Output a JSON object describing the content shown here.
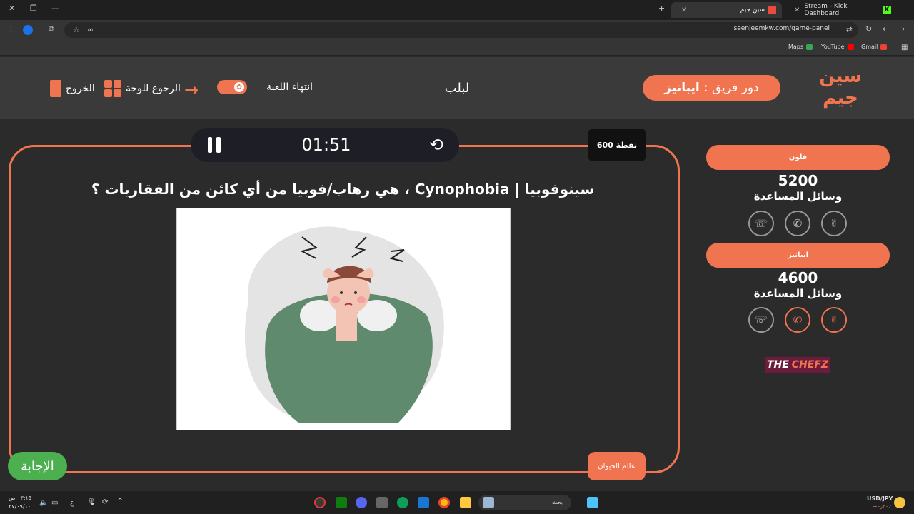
{
  "browser": {
    "tabs": [
      {
        "title": "سين جيم",
        "active": true
      },
      {
        "title": "Stream - Kick Dashboard",
        "active": false
      }
    ],
    "url": "seenjeemkw.com/game-panel",
    "bookmarks": [
      "Maps",
      "YouTube",
      "Gmail"
    ]
  },
  "header": {
    "logo_text": "سين جيم",
    "turn_prefix": "دور فريق :",
    "turn_team": "ايبانيز",
    "center_title": "لبلب",
    "end_game_label": "انتهاء اللعبة",
    "back_board_label": "الرجوع للوحة",
    "exit_label": "الخروج"
  },
  "game": {
    "timer": "01:51",
    "points": "600 نقطة",
    "question": "سينوفوبيا | Cynophobia ، هي رهاب/فوبيا من أي كائن من الفقاريات ؟",
    "category": "عالم الحيوان",
    "answer_label": "الإجابة"
  },
  "teams": [
    {
      "name": "فلون",
      "score": "5200",
      "aids_label": "وسائل المساعدة",
      "aids_active": [
        false,
        false,
        false
      ]
    },
    {
      "name": "ايبانيز",
      "score": "4600",
      "aids_label": "وسائل المساعدة",
      "aids_active": [
        false,
        true,
        true
      ]
    }
  ],
  "sponsor": {
    "part1": "THE",
    "part2": "CHEFZ"
  },
  "taskbar": {
    "search_placeholder": "بحث",
    "currency": "USD/JPY",
    "currency_change": "+٠٫٣٠٪",
    "time": "٠٣:١٥ ص",
    "date": "٢٧/٠٩/١٠",
    "lang": "ع"
  },
  "colors": {
    "accent": "#f0744f",
    "answer": "#4caf50",
    "background": "#2b2b2b"
  }
}
